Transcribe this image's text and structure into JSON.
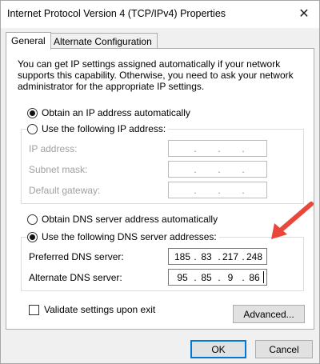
{
  "window": {
    "title": "Internet Protocol Version 4 (TCP/IPv4) Properties",
    "close_glyph": "✕"
  },
  "tabs": [
    {
      "label": "General",
      "active": true
    },
    {
      "label": "Alternate Configuration",
      "active": false
    }
  ],
  "general": {
    "description": "You can get IP settings assigned automatically if your network supports this capability. Otherwise, you need to ask your network administrator for the appropriate IP settings.",
    "ip_auto_label": "Obtain an IP address automatically",
    "ip_manual_label": "Use the following IP address:",
    "ip_fields": [
      {
        "label": "IP address:"
      },
      {
        "label": "Subnet mask:"
      },
      {
        "label": "Default gateway:"
      }
    ],
    "dns_auto_label": "Obtain DNS server address automatically",
    "dns_manual_label": "Use the following DNS server addresses:",
    "preferred_dns_label": "Preferred DNS server:",
    "preferred_dns": [
      "185",
      "83",
      "217",
      "248"
    ],
    "alternate_dns_label": "Alternate DNS server:",
    "alternate_dns": [
      "95",
      "85",
      "9",
      "86"
    ],
    "dot": ".",
    "validate_label": "Validate settings upon exit",
    "advanced_label": "Advanced..."
  },
  "footer": {
    "ok_label": "OK",
    "cancel_label": "Cancel"
  },
  "colors": {
    "annotation_arrow": "#e8473a",
    "focus_border": "#0078d7"
  }
}
